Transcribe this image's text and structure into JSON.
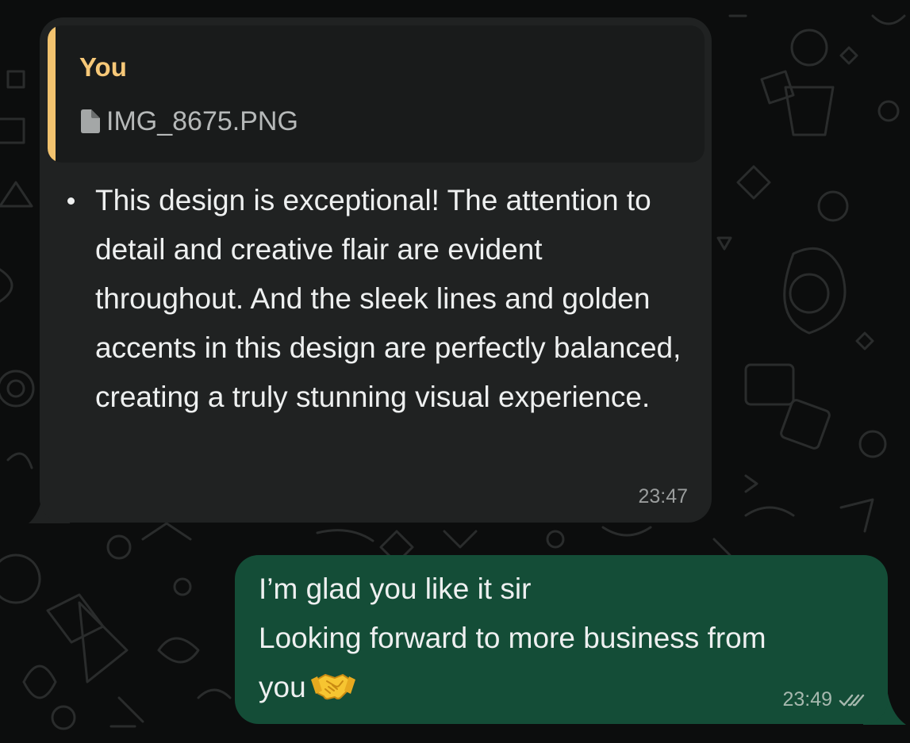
{
  "colors": {
    "background": "#0c0d0d",
    "incoming_bubble": "#202222",
    "quote_background": "#191b1b",
    "quote_accent": "#f2c36f",
    "outgoing_bubble": "#144d37",
    "text": "#eef0f0"
  },
  "incoming": {
    "reply_quote": {
      "author": "You",
      "file_icon": "document-icon",
      "file_name": "IMG_8675.PNG"
    },
    "bullets": [
      "This design is exceptional! The attention to detail and creative flair are evident throughout. And the sleek lines and golden accents in this design are perfectly balanced, creating a truly stunning visual experience."
    ],
    "time": "23:47"
  },
  "outgoing": {
    "lines": [
      "I’m glad you like it sir",
      "Looking forward to more business from",
      "you"
    ],
    "emoji": "handshake-emoji",
    "time": "23:49",
    "status_icon": "read-ticks-icon"
  }
}
